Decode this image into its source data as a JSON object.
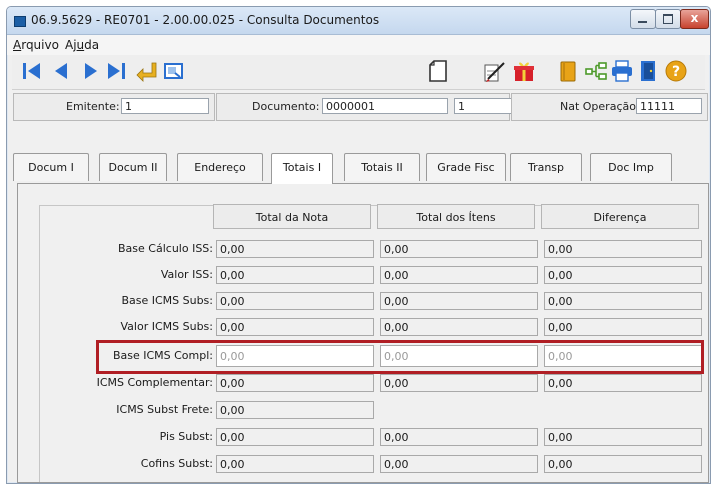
{
  "window": {
    "title": "06.9.5629 - RE0701 - 2.00.00.025 - Consulta Documentos",
    "minimize_glyph": "",
    "maximize_glyph": "",
    "close_glyph": "x"
  },
  "menu": {
    "arquivo": {
      "pre": "",
      "underlined": "A",
      "post": "rquivo"
    },
    "ajuda": {
      "pre": "Aj",
      "underlined": "u",
      "post": "da"
    }
  },
  "toolbar_icons": {
    "left": [
      "first-record-icon",
      "previous-record-icon",
      "next-record-icon",
      "last-record-icon",
      "goto-record-icon",
      "search-zoom-icon"
    ],
    "right": [
      "blank-page-icon",
      "edit-gift-icon",
      "book-icon",
      "tree-icon",
      "print-icon",
      "exit-door-icon",
      "help-icon"
    ]
  },
  "header": {
    "emitente_label": "Emitente:",
    "emitente_value": "1",
    "documento_label": "Documento:",
    "documento_value": "0000001",
    "serie_value": "1",
    "nat_label": "Nat Operação:",
    "nat_value": "11111"
  },
  "tabs": [
    "Docum I",
    "Docum II",
    "Endereço",
    "Totais I",
    "Totais II",
    "Grade Fisc",
    "Transp",
    "Doc Imp"
  ],
  "active_tab": "Totais I",
  "totals": {
    "columns": [
      "Total da Nota",
      "Total dos Ítens",
      "Diferença"
    ],
    "rows": [
      {
        "label": "Base Cálculo ISS:",
        "values": [
          "0,00",
          "0,00",
          "0,00"
        ]
      },
      {
        "label": "Valor ISS:",
        "values": [
          "0,00",
          "0,00",
          "0,00"
        ]
      },
      {
        "label": "Base ICMS Subs:",
        "values": [
          "0,00",
          "0,00",
          "0,00"
        ]
      },
      {
        "label": "Valor ICMS Subs:",
        "values": [
          "0,00",
          "0,00",
          "0,00"
        ]
      },
      {
        "label": "Base ICMS Compl:",
        "values": [
          "0,00",
          "0,00",
          "0,00"
        ]
      },
      {
        "label": "ICMS Complementar:",
        "values": [
          "0,00",
          "0,00",
          "0,00"
        ]
      },
      {
        "label": "ICMS Subst Frete:",
        "values": [
          "0,00"
        ]
      },
      {
        "label": "Pis Subst:",
        "values": [
          "0,00",
          "0,00",
          "0,00"
        ]
      },
      {
        "label": "Cofins Subst:",
        "values": [
          "0,00",
          "0,00",
          "0,00"
        ]
      }
    ]
  },
  "colors": {
    "highlight": "#b01e24",
    "accent_blue": "#2a6fd0",
    "gold": "#e8a317"
  }
}
